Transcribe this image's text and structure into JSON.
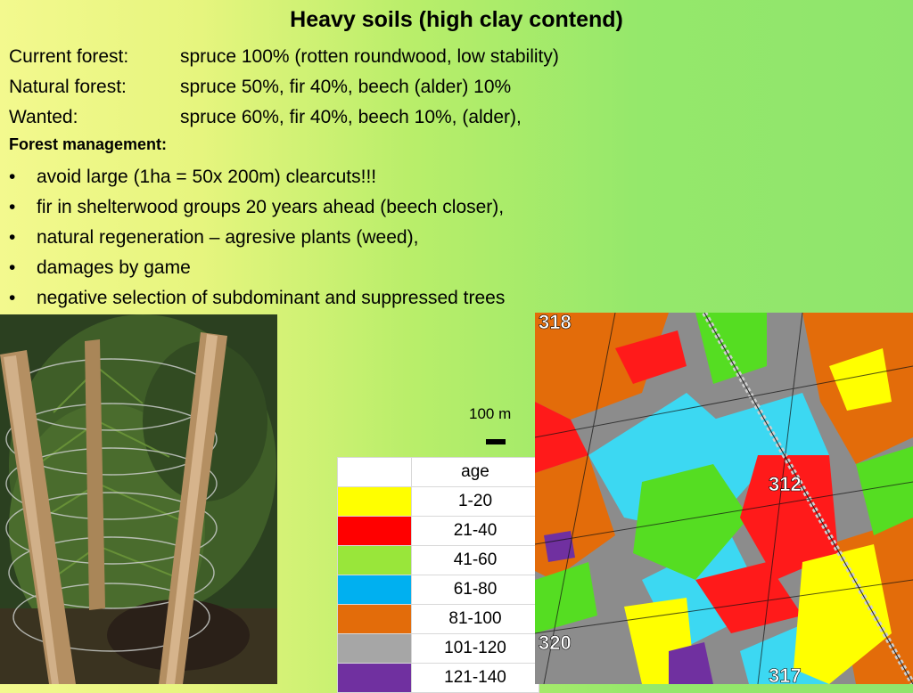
{
  "title": "Heavy soils (high clay contend)",
  "rows": [
    {
      "label": "Current forest:",
      "value": "spruce 100% (rotten roundwood, low stability)"
    },
    {
      "label": "Natural forest:",
      "value": "spruce 50%, fir 40%, beech (alder) 10%"
    },
    {
      "label": "Wanted:",
      "value": "spruce  60%, fir 40%, beech 10%, (alder),"
    }
  ],
  "management_heading": "Forest management:",
  "bullets": [
    "avoid large (1ha = 50x 200m) clearcuts!!!",
    "fir in shelterwood groups 20 years ahead (beech closer),",
    "natural regeneration – agresive plants (weed),",
    "damages by game",
    "negative selection of subdominant and suppressed trees"
  ],
  "bullet_char": "•",
  "scale": {
    "label": "100 m"
  },
  "legend": {
    "header": "age",
    "items": [
      {
        "label": "1-20",
        "color": "#ffff00"
      },
      {
        "label": "21-40",
        "color": "#ff0000"
      },
      {
        "label": "41-60",
        "color": "#99e63a"
      },
      {
        "label": "61-80",
        "color": "#00b0f0"
      },
      {
        "label": "81-100",
        "color": "#e36c0a"
      },
      {
        "label": "101-120",
        "color": "#a6a6a6"
      },
      {
        "label": "121-140",
        "color": "#7030a0"
      }
    ]
  },
  "map_labels": {
    "c318": "318",
    "c312": "312",
    "c320": "320",
    "c317": "317"
  }
}
